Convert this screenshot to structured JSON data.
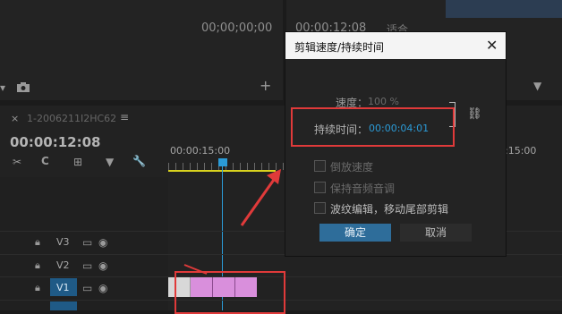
{
  "program_monitor": {
    "timecode": "00;00;00;00"
  },
  "source_monitor": {
    "timecode": "00:00:12:08",
    "fit_label": "适合"
  },
  "timeline": {
    "tab_label": "1-2006211I2HC62",
    "timecode": "00:00:12:08",
    "ruler_tick_left": "00:00:15:00",
    "ruler_tick_right": ":15:00",
    "tracks": [
      {
        "name": "V3"
      },
      {
        "name": "V2"
      },
      {
        "name": "V1"
      }
    ]
  },
  "dialog": {
    "title": "剪辑速度/持续时间",
    "speed_label": "速度：",
    "speed_value": "100 %",
    "duration_label": "持续时间：",
    "duration_value": "00:00:04:01",
    "options": [
      {
        "label": "倒放速度"
      },
      {
        "label": "保持音频音调"
      },
      {
        "label": "波纹编辑，移动尾部剪辑"
      }
    ],
    "ok_label": "确定",
    "cancel_label": "取消"
  },
  "colors": {
    "accent_blue": "#2b9bd7",
    "annotation_red": "#e03a3a",
    "clip_pink": "#d98fdc"
  }
}
